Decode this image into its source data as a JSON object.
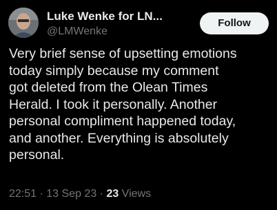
{
  "author": {
    "display_name": "Luke Wenke for LN...",
    "handle": "@LMWenke"
  },
  "follow_label": "Follow",
  "tweet_text": "Very brief sense of upsetting emotions\ntoday simply because my comment\ngot deleted from the Olean Times\nHerald.  I took it personally.  Another\npersonal compliment happened today,\nand another.  Everything is absolutely\npersonal.",
  "meta": {
    "time": "22:51",
    "sep1": " · ",
    "date": "13 Sep 23",
    "sep2": " · ",
    "views_count": "23",
    "views_label": " Views"
  },
  "colors": {
    "background": "#000000",
    "primary_text": "#e7e9ea",
    "secondary_text": "#71767b",
    "follow_button_bg": "#eff3f4"
  }
}
